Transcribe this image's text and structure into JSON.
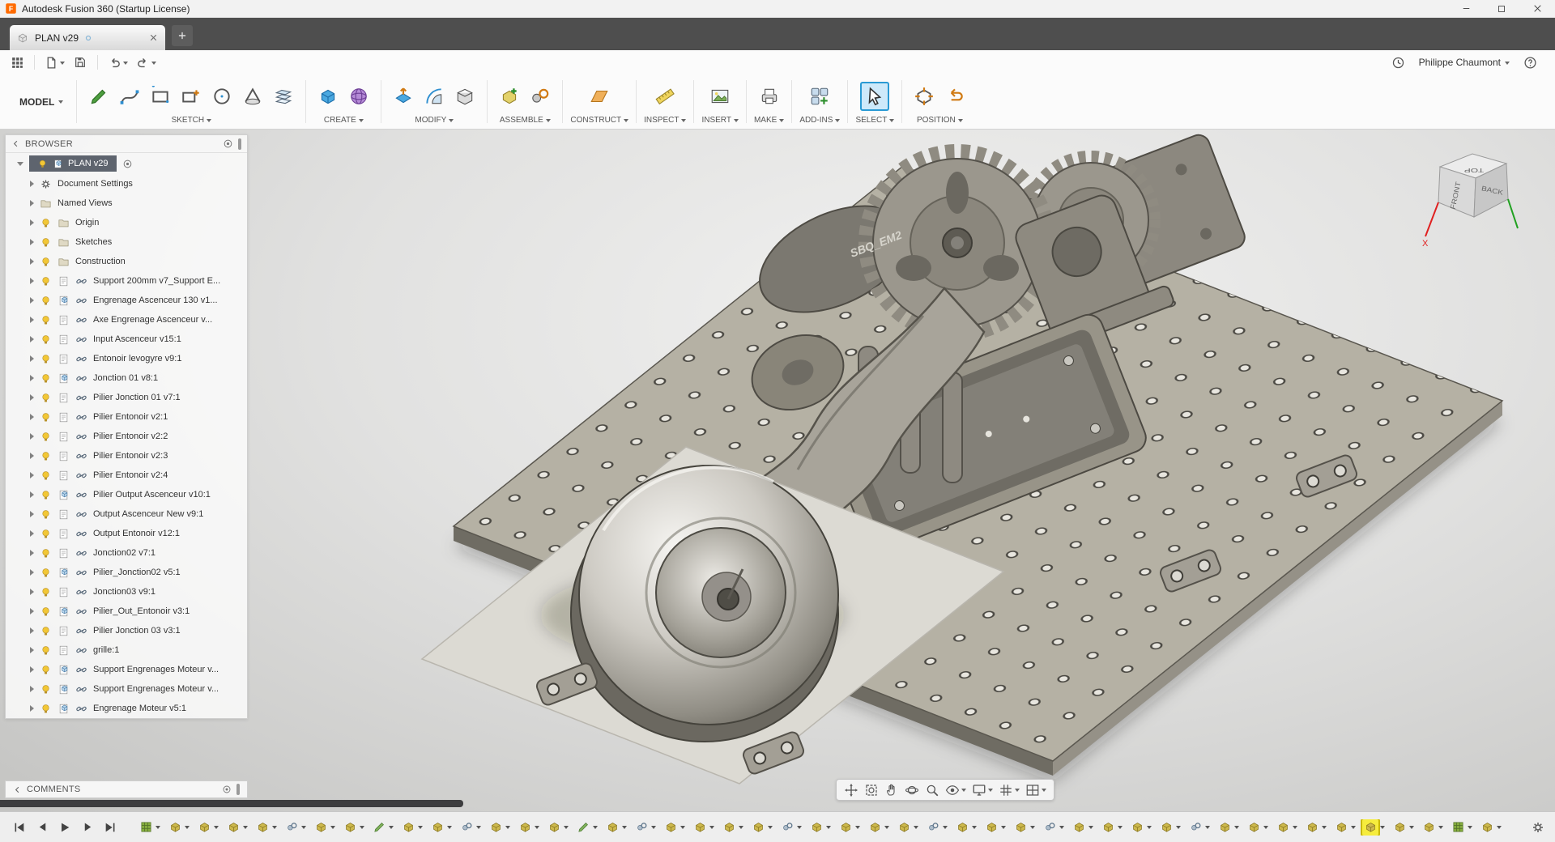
{
  "window": {
    "title": "Autodesk Fusion 360 (Startup License)"
  },
  "tabs": {
    "active": "PLAN v29"
  },
  "mode": {
    "label": "MODEL"
  },
  "user": {
    "name": "Philippe Chaumont"
  },
  "ribbon": {
    "groups": [
      {
        "label": "SKETCH",
        "icons": [
          "pencil",
          "spline",
          "rect",
          "rectplus",
          "circle",
          "cone",
          "sheets"
        ]
      },
      {
        "label": "CREATE",
        "icons": [
          "box3d",
          "spheregrid"
        ]
      },
      {
        "label": "MODIFY",
        "icons": [
          "presspull",
          "fillet",
          "shell"
        ]
      },
      {
        "label": "ASSEMBLE",
        "icons": [
          "newcomp",
          "joint3"
        ]
      },
      {
        "label": "CONSTRUCT",
        "icons": [
          "plane"
        ]
      },
      {
        "label": "INSPECT",
        "icons": [
          "measure"
        ]
      },
      {
        "label": "INSERT",
        "icons": [
          "canvasimg"
        ]
      },
      {
        "label": "MAKE",
        "icons": [
          "print3d"
        ]
      },
      {
        "label": "ADD-INS",
        "icons": [
          "addins"
        ]
      },
      {
        "label": "SELECT",
        "icons": [
          {
            "k": "cursor",
            "hl": true
          }
        ]
      },
      {
        "label": "POSITION",
        "icons": [
          "capturepos",
          "revertpos"
        ]
      }
    ]
  },
  "browser": {
    "title": "BROWSER",
    "root_label": "PLAN v29",
    "items": [
      {
        "label": "Document Settings",
        "icons": [
          "gearsm"
        ]
      },
      {
        "label": "Named Views",
        "icons": [
          "folder"
        ]
      },
      {
        "label": "Origin",
        "icons": [
          "bulb",
          "folder"
        ]
      },
      {
        "label": "Sketches",
        "icons": [
          "bulb",
          "folder"
        ]
      },
      {
        "label": "Construction",
        "icons": [
          "bulb",
          "folder"
        ]
      },
      {
        "label": "Support 200mm v7_Support E...",
        "icons": [
          "bulb",
          "comp",
          "link"
        ]
      },
      {
        "label": "Engrenage Ascenceur 130 v1...",
        "icons": [
          "bulb",
          "body",
          "link"
        ]
      },
      {
        "label": "Axe Engrenage Ascenceur v...",
        "icons": [
          "bulb",
          "comp",
          "link"
        ]
      },
      {
        "label": "Input Ascenceur v15:1",
        "icons": [
          "bulb",
          "comp",
          "link"
        ]
      },
      {
        "label": "Entonoir levogyre v9:1",
        "icons": [
          "bulb",
          "comp",
          "link"
        ]
      },
      {
        "label": "Jonction 01 v8:1",
        "icons": [
          "bulb",
          "body",
          "link"
        ]
      },
      {
        "label": "Pilier Jonction 01 v7:1",
        "icons": [
          "bulb",
          "comp",
          "link"
        ]
      },
      {
        "label": "Pilier Entonoir v2:1",
        "icons": [
          "bulb",
          "comp",
          "link"
        ]
      },
      {
        "label": "Pilier Entonoir v2:2",
        "icons": [
          "bulb",
          "comp",
          "link"
        ]
      },
      {
        "label": "Pilier Entonoir v2:3",
        "icons": [
          "bulb",
          "comp",
          "link"
        ]
      },
      {
        "label": "Pilier Entonoir v2:4",
        "icons": [
          "bulb",
          "comp",
          "link"
        ]
      },
      {
        "label": "Pilier Output Ascenceur v10:1",
        "icons": [
          "bulb",
          "body",
          "link"
        ]
      },
      {
        "label": "Output Ascenceur New v9:1",
        "icons": [
          "bulb",
          "comp",
          "link"
        ]
      },
      {
        "label": "Output Entonoir v12:1",
        "icons": [
          "bulb",
          "comp",
          "link"
        ]
      },
      {
        "label": "Jonction02 v7:1",
        "icons": [
          "bulb",
          "comp",
          "link"
        ]
      },
      {
        "label": "Pilier_Jonction02 v5:1",
        "icons": [
          "bulb",
          "body",
          "link"
        ]
      },
      {
        "label": "Jonction03 v9:1",
        "icons": [
          "bulb",
          "comp",
          "link"
        ]
      },
      {
        "label": "Pilier_Out_Entonoir v3:1",
        "icons": [
          "bulb",
          "body",
          "link"
        ]
      },
      {
        "label": "Pilier Jonction 03 v3:1",
        "icons": [
          "bulb",
          "comp",
          "link"
        ]
      },
      {
        "label": "grille:1",
        "icons": [
          "bulb",
          "comp",
          "link"
        ]
      },
      {
        "label": "Support Engrenages Moteur v...",
        "icons": [
          "bulb",
          "body",
          "link"
        ]
      },
      {
        "label": "Support Engrenages Moteur v...",
        "icons": [
          "bulb",
          "body",
          "link"
        ]
      },
      {
        "label": "Engrenage Moteur v5:1",
        "icons": [
          "bulb",
          "body",
          "link"
        ]
      }
    ]
  },
  "comments": {
    "title": "COMMENTS"
  },
  "viewcube": {
    "top": "TOP",
    "front": "FRONT",
    "back": "BACK",
    "axis_x": "X"
  },
  "model": {
    "engraving": "SBQ_EM2"
  },
  "timeline": {
    "features": [
      "ground",
      "comp",
      "comp",
      "comp",
      "comp",
      "joint",
      "comp",
      "comp",
      "sketch",
      "comp",
      "comp",
      "joint",
      "comp",
      "comp",
      "comp",
      "sketch",
      "comp",
      "joint",
      "comp",
      "comp",
      "comp",
      "comp",
      "joint",
      "comp",
      "comp",
      "comp",
      "comp",
      "joint",
      "comp",
      "comp",
      "comp",
      "joint",
      "comp",
      "comp",
      "comp",
      "comp",
      "joint",
      "comp",
      "comp",
      "comp",
      "comp",
      "comp",
      {
        "k": "comp",
        "hl": true
      },
      "comp",
      "comp",
      "ground",
      "comp"
    ]
  },
  "colors": {
    "accent_blue": "#0696d7",
    "select_highlight": "#cde9fa",
    "tab_bar": "#4e4e4e",
    "root_row": "#5e646e",
    "timeline_highlight": "#f6ec3d"
  }
}
